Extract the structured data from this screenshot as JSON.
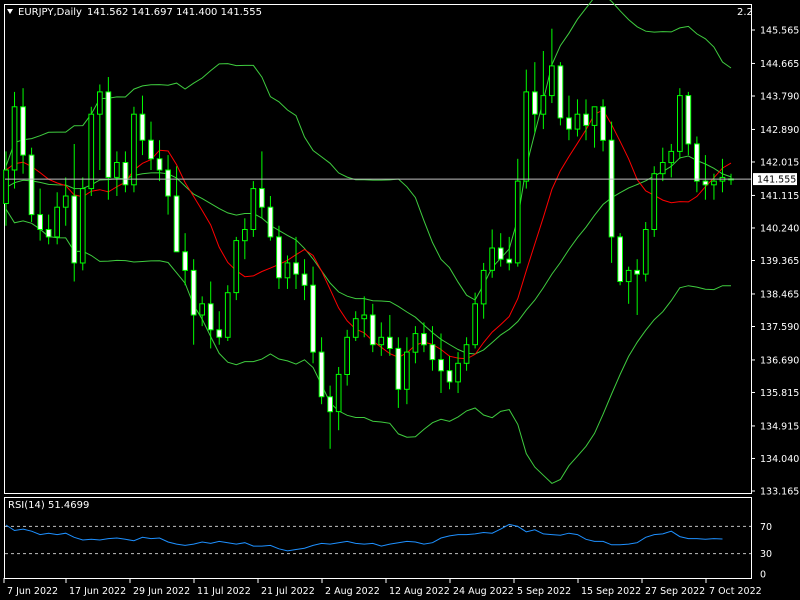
{
  "header": {
    "symbol_label": "EURJPY,Daily",
    "ohlc": "141.562 141.697 141.400 141.555",
    "corner_value": "2.2"
  },
  "rsi_panel": {
    "label": "RSI(14) 51.4699",
    "levels": [
      70,
      30
    ],
    "axis_ticks": [
      "70",
      "30",
      "0"
    ]
  },
  "colors": {
    "background": "#000000",
    "frame": "#ffffff",
    "candle": "#00ff00",
    "bull_body": "#000000",
    "bear_body": "#ffffff",
    "ma": "#ff0000",
    "bands": "#3fcc3f",
    "rsi": "#1e90ff",
    "price_line": "#c0c0c0"
  },
  "chart_data": {
    "type": "candlestick",
    "y_ticks": [
      "145.565",
      "144.665",
      "143.790",
      "142.890",
      "142.015",
      "141.115",
      "140.240",
      "139.365",
      "138.465",
      "137.590",
      "136.690",
      "135.815",
      "134.915",
      "134.040",
      "133.165"
    ],
    "current_price": "141.555",
    "x_ticks": [
      "7 Jun 2022",
      "17 Jun 2022",
      "29 Jun 2022",
      "11 Jul 2022",
      "21 Jul 2022",
      "2 Aug 2022",
      "12 Aug 2022",
      "24 Aug 2022",
      "5 Sep 2022",
      "15 Sep 2022",
      "27 Sep 2022",
      "7 Oct 2022"
    ],
    "ylim": [
      133.0,
      146.3
    ],
    "candles": [
      [
        140.9,
        142.3,
        140.3,
        141.8
      ],
      [
        141.8,
        143.9,
        141.3,
        143.5
      ],
      [
        143.5,
        144.0,
        141.7,
        142.2
      ],
      [
        142.2,
        142.4,
        140.4,
        140.6
      ],
      [
        140.6,
        141.3,
        139.9,
        140.2
      ],
      [
        140.2,
        140.6,
        139.8,
        140.0
      ],
      [
        140.0,
        141.2,
        139.8,
        140.8
      ],
      [
        140.8,
        141.6,
        140.3,
        141.1
      ],
      [
        141.1,
        142.5,
        138.8,
        139.3
      ],
      [
        139.3,
        141.6,
        139.1,
        141.3
      ],
      [
        141.3,
        143.5,
        141.1,
        143.3
      ],
      [
        143.3,
        144.1,
        141.8,
        143.9
      ],
      [
        143.9,
        144.3,
        141.0,
        141.6
      ],
      [
        141.6,
        142.3,
        141.1,
        142.0
      ],
      [
        142.0,
        142.3,
        141.2,
        141.4
      ],
      [
        141.4,
        143.5,
        141.2,
        143.3
      ],
      [
        143.3,
        143.8,
        142.2,
        142.6
      ],
      [
        142.6,
        143.1,
        141.8,
        142.1
      ],
      [
        142.1,
        142.6,
        141.5,
        141.8
      ],
      [
        141.8,
        142.2,
        140.6,
        141.1
      ],
      [
        141.1,
        141.9,
        140.6,
        139.6
      ],
      [
        139.6,
        140.1,
        138.7,
        139.1
      ],
      [
        139.1,
        139.4,
        137.1,
        137.9
      ],
      [
        137.9,
        138.4,
        137.6,
        138.2
      ],
      [
        138.2,
        138.8,
        137.0,
        137.5
      ],
      [
        137.5,
        138.0,
        137.1,
        137.3
      ],
      [
        137.3,
        138.7,
        137.2,
        138.5
      ],
      [
        138.5,
        140.0,
        138.3,
        139.9
      ],
      [
        139.9,
        140.5,
        139.4,
        140.2
      ],
      [
        140.2,
        141.5,
        140.0,
        141.3
      ],
      [
        141.3,
        142.3,
        140.5,
        140.8
      ],
      [
        140.8,
        141.1,
        139.9,
        140.0
      ],
      [
        140.0,
        140.3,
        138.6,
        138.9
      ],
      [
        138.9,
        139.5,
        138.6,
        139.3
      ],
      [
        139.3,
        140.0,
        138.6,
        139.0
      ],
      [
        139.0,
        139.4,
        138.3,
        138.7
      ],
      [
        138.7,
        139.2,
        136.6,
        136.9
      ],
      [
        136.9,
        137.3,
        135.5,
        135.7
      ],
      [
        135.7,
        136.0,
        134.3,
        135.3
      ],
      [
        135.3,
        136.5,
        134.8,
        136.3
      ],
      [
        136.3,
        137.5,
        136.0,
        137.3
      ],
      [
        137.3,
        138.0,
        137.2,
        137.8
      ],
      [
        137.8,
        138.4,
        137.3,
        137.9
      ],
      [
        137.9,
        138.2,
        136.9,
        137.1
      ],
      [
        137.1,
        137.7,
        136.8,
        137.3
      ],
      [
        137.3,
        137.9,
        136.8,
        137.0
      ],
      [
        137.0,
        137.3,
        135.4,
        135.9
      ],
      [
        135.9,
        137.3,
        135.5,
        136.9
      ],
      [
        136.9,
        137.6,
        136.6,
        137.4
      ],
      [
        137.4,
        137.7,
        136.9,
        137.1
      ],
      [
        137.1,
        137.6,
        136.4,
        136.7
      ],
      [
        136.7,
        137.4,
        135.8,
        136.4
      ],
      [
        136.4,
        136.8,
        135.9,
        136.1
      ],
      [
        136.1,
        136.9,
        135.8,
        136.6
      ],
      [
        136.6,
        137.3,
        136.4,
        137.1
      ],
      [
        137.1,
        138.5,
        137.0,
        138.2
      ],
      [
        138.2,
        139.3,
        137.8,
        139.1
      ],
      [
        139.1,
        140.2,
        138.9,
        139.7
      ],
      [
        139.7,
        140.1,
        139.2,
        139.4
      ],
      [
        139.4,
        140.0,
        139.1,
        139.3
      ],
      [
        139.3,
        142.1,
        139.2,
        141.5
      ],
      [
        141.5,
        144.5,
        141.3,
        143.9
      ],
      [
        143.9,
        144.7,
        142.8,
        143.3
      ],
      [
        143.3,
        145.0,
        142.9,
        143.8
      ],
      [
        143.8,
        145.6,
        143.6,
        144.6
      ],
      [
        144.6,
        144.7,
        143.0,
        143.2
      ],
      [
        143.2,
        143.8,
        142.6,
        142.9
      ],
      [
        142.9,
        143.7,
        142.7,
        143.3
      ],
      [
        143.3,
        143.7,
        142.6,
        143.0
      ],
      [
        143.0,
        143.4,
        142.4,
        143.5
      ],
      [
        143.5,
        143.7,
        142.3,
        142.6
      ],
      [
        142.6,
        143.1,
        139.3,
        140.0
      ],
      [
        140.0,
        140.1,
        138.7,
        138.8
      ],
      [
        138.8,
        139.2,
        138.2,
        139.1
      ],
      [
        139.1,
        139.4,
        137.9,
        139.0
      ],
      [
        139.0,
        140.4,
        138.8,
        140.2
      ],
      [
        140.2,
        141.9,
        140.0,
        141.7
      ],
      [
        141.7,
        142.4,
        141.5,
        142.0
      ],
      [
        142.0,
        142.5,
        141.6,
        142.3
      ],
      [
        142.3,
        144.0,
        142.1,
        143.8
      ],
      [
        143.8,
        143.9,
        142.2,
        142.5
      ],
      [
        142.5,
        142.7,
        141.2,
        141.5
      ],
      [
        141.5,
        142.2,
        141.0,
        141.4
      ],
      [
        141.4,
        141.7,
        141.0,
        141.5
      ],
      [
        141.5,
        142.1,
        141.2,
        141.6
      ],
      [
        141.56,
        141.7,
        141.4,
        141.555
      ]
    ],
    "rsi": [
      72,
      64,
      66,
      63,
      58,
      60,
      58,
      60,
      54,
      50,
      51,
      50,
      52,
      53,
      51,
      49,
      54,
      52,
      53,
      47,
      44,
      42,
      44,
      47,
      45,
      48,
      46,
      44,
      46,
      41,
      41,
      42,
      37,
      34,
      36,
      38,
      42,
      45,
      44,
      46,
      48,
      45,
      44,
      45,
      41,
      44,
      46,
      48,
      47,
      44,
      46,
      53,
      56,
      58,
      58,
      59,
      61,
      60,
      66,
      73,
      70,
      62,
      65,
      59,
      58,
      57,
      60,
      58,
      51,
      48,
      48,
      43,
      43,
      44,
      46,
      54,
      58,
      59,
      63,
      55,
      52,
      52,
      51,
      52,
      51.47
    ]
  }
}
